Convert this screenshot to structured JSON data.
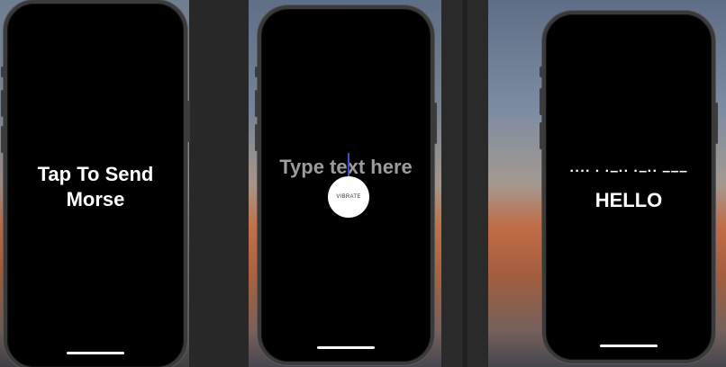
{
  "screen1": {
    "prompt": "Tap To Send\nMorse"
  },
  "screen2": {
    "placeholder": "Type text here",
    "vibrate_label": "VIBRATE"
  },
  "screen3": {
    "morse": "···· · ·–·· ·–·· –––",
    "decoded": "HELLO"
  }
}
